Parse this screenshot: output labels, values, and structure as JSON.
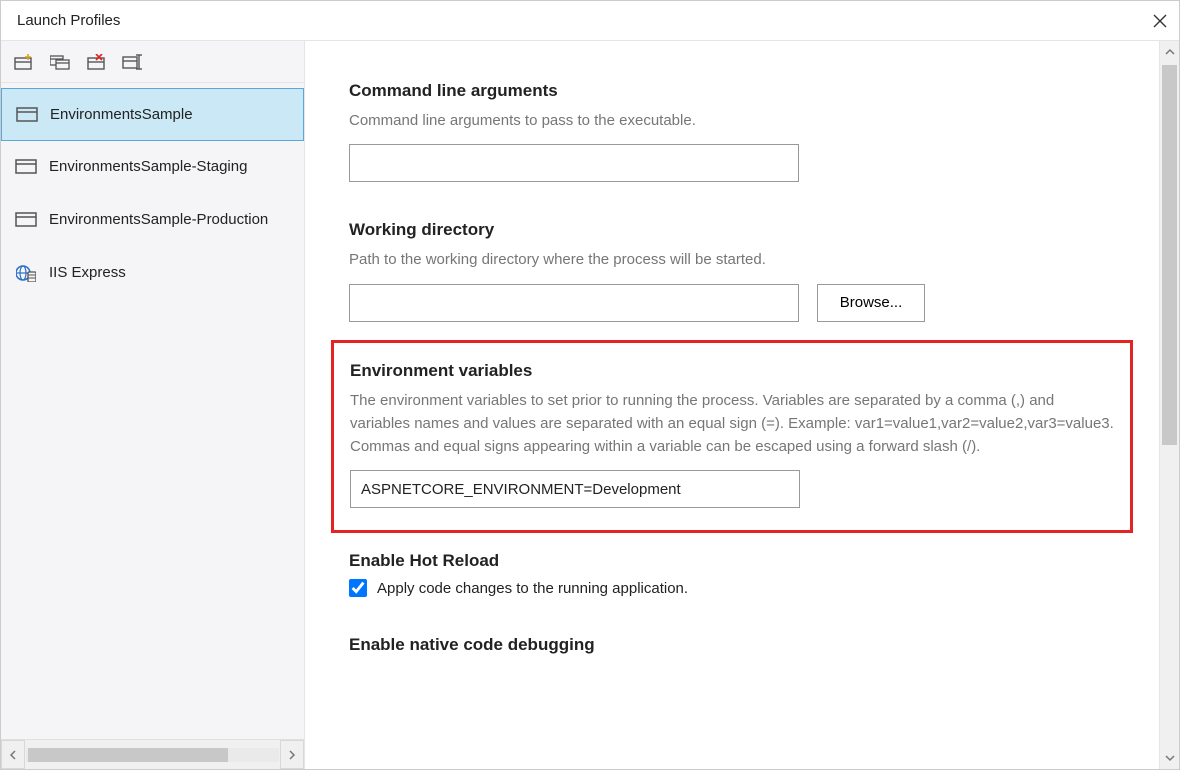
{
  "window": {
    "title": "Launch Profiles"
  },
  "toolbar": {
    "new": "New",
    "duplicate": "Duplicate",
    "delete": "Delete",
    "rename": "Rename"
  },
  "profiles": [
    {
      "label": "EnvironmentsSample",
      "type": "project",
      "selected": true
    },
    {
      "label": "EnvironmentsSample-Staging",
      "type": "project",
      "selected": false
    },
    {
      "label": "EnvironmentsSample-Production",
      "type": "project",
      "selected": false
    },
    {
      "label": "IIS Express",
      "type": "iis",
      "selected": false
    }
  ],
  "sections": {
    "cmdline": {
      "title": "Command line arguments",
      "desc": "Command line arguments to pass to the executable.",
      "value": ""
    },
    "workdir": {
      "title": "Working directory",
      "desc": "Path to the working directory where the process will be started.",
      "value": "",
      "browse": "Browse..."
    },
    "envvars": {
      "title": "Environment variables",
      "desc": "The environment variables to set prior to running the process. Variables are separated by a comma (,) and variables names and values are separated with an equal sign (=). Example: var1=value1,var2=value2,var3=value3. Commas and equal signs appearing within a variable can be escaped using a forward slash (/).",
      "value": "ASPNETCORE_ENVIRONMENT=Development"
    },
    "hotreload": {
      "title": "Enable Hot Reload",
      "checkbox_label": "Apply code changes to the running application.",
      "checked": true
    },
    "nativedebug": {
      "title": "Enable native code debugging"
    }
  }
}
